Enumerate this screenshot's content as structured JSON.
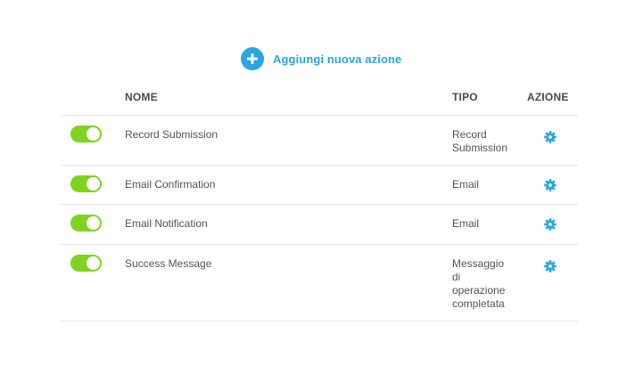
{
  "header": {
    "add_action_label": "Aggiungi nuova azione"
  },
  "table": {
    "columns": {
      "nome": "NOME",
      "tipo": "TIPO",
      "azione": "AZIONE"
    },
    "rows": [
      {
        "enabled": true,
        "name": "Record Submission",
        "type": "Record Submission",
        "action_icon": "gear-icon"
      },
      {
        "enabled": true,
        "name": "Email Confirmation",
        "type": "Email",
        "action_icon": "gear-icon"
      },
      {
        "enabled": true,
        "name": "Email Notification",
        "type": "Email",
        "action_icon": "gear-icon"
      },
      {
        "enabled": true,
        "name": "Success Message",
        "type": "Messaggio di operazione completata",
        "action_icon": "gear-icon"
      }
    ]
  },
  "colors": {
    "accent": "#29a7e1",
    "toggle_on": "#7ed321"
  }
}
